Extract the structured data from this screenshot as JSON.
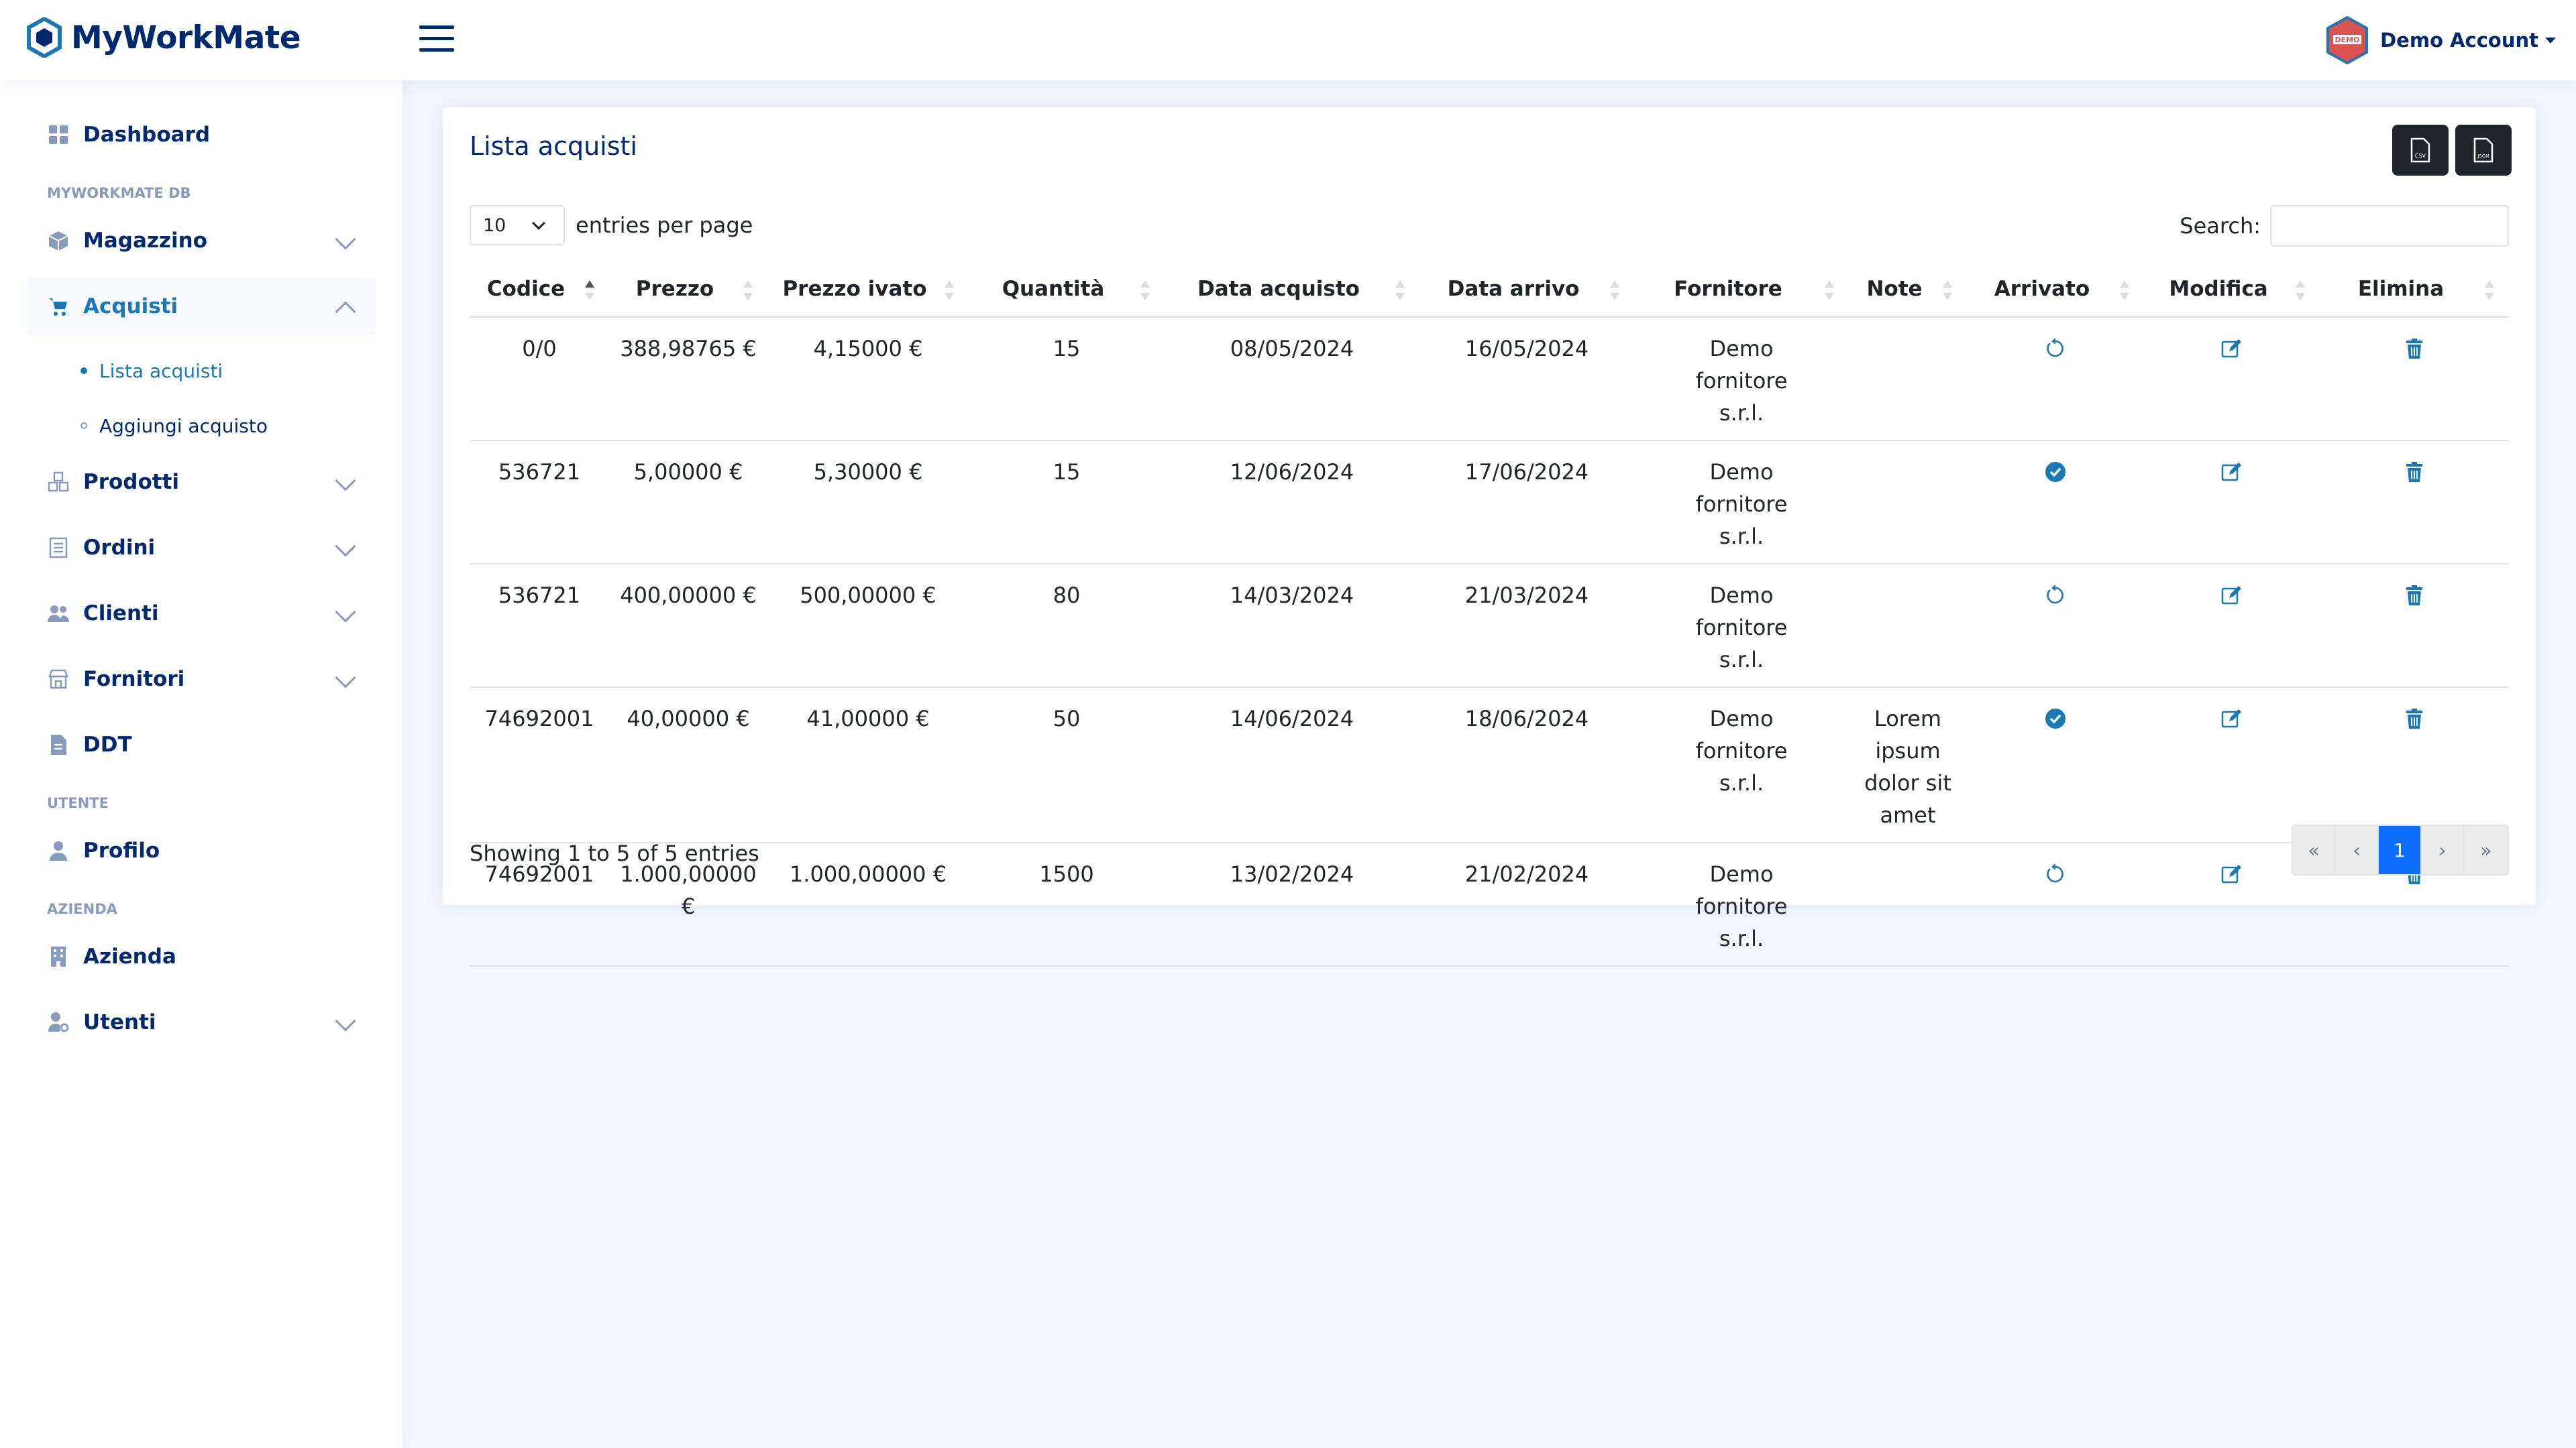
{
  "header": {
    "logo_text": "MyWorkMate",
    "account_name": "Demo Account",
    "avatar_badge": "DEMO"
  },
  "sidebar": {
    "dashboard": "Dashboard",
    "heading_db": "MYWORKMATE DB",
    "magazzino": "Magazzino",
    "acquisti": "Acquisti",
    "lista_acquisti": "Lista acquisti",
    "aggiungi_acquisto": "Aggiungi acquisto",
    "prodotti": "Prodotti",
    "ordini": "Ordini",
    "clienti": "Clienti",
    "fornitori": "Fornitori",
    "ddt": "DDT",
    "heading_utente": "UTENTE",
    "profilo": "Profilo",
    "heading_azienda": "AZIENDA",
    "azienda": "Azienda",
    "utenti": "Utenti"
  },
  "main": {
    "title": "Lista acquisti",
    "export_csv": "CSV",
    "export_json": "JSON",
    "entries_value": "10",
    "entries_label": "entries per page",
    "search_label": "Search:",
    "search_value": "",
    "columns": [
      "Codice",
      "Prezzo",
      "Prezzo ivato",
      "Quantità",
      "Data acquisto",
      "Data arrivo",
      "Fornitore",
      "Note",
      "Arrivato",
      "Modifica",
      "Elimina"
    ],
    "rows": [
      {
        "codice": "0/0",
        "prezzo": "388,98765 €",
        "prezzo_ivato": "4,15000 €",
        "quantita": "15",
        "data_acquisto": "08/05/2024",
        "data_arrivo": "16/05/2024",
        "fornitore": "Demo fornitore s.r.l.",
        "note": "",
        "arrivato": "pending"
      },
      {
        "codice": "536721",
        "prezzo": "5,00000 €",
        "prezzo_ivato": "5,30000 €",
        "quantita": "15",
        "data_acquisto": "12/06/2024",
        "data_arrivo": "17/06/2024",
        "fornitore": "Demo fornitore s.r.l.",
        "note": "",
        "arrivato": "arrived"
      },
      {
        "codice": "536721",
        "prezzo": "400,00000 €",
        "prezzo_ivato": "500,00000 €",
        "quantita": "80",
        "data_acquisto": "14/03/2024",
        "data_arrivo": "21/03/2024",
        "fornitore": "Demo fornitore s.r.l.",
        "note": "",
        "arrivato": "pending"
      },
      {
        "codice": "74692001",
        "prezzo": "40,00000 €",
        "prezzo_ivato": "41,00000 €",
        "quantita": "50",
        "data_acquisto": "14/06/2024",
        "data_arrivo": "18/06/2024",
        "fornitore": "Demo fornitore s.r.l.",
        "note": "Lorem ipsum dolor sit amet",
        "arrivato": "arrived"
      },
      {
        "codice": "74692001",
        "prezzo": "1.000,00000 €",
        "prezzo_ivato": "1.000,00000 €",
        "quantita": "1500",
        "data_acquisto": "13/02/2024",
        "data_arrivo": "21/02/2024",
        "fornitore": "Demo fornitore s.r.l.",
        "note": "",
        "arrivato": "pending"
      }
    ],
    "footer_info": "Showing 1 to 5 of 5 entries",
    "pager": {
      "first": "«",
      "prev": "‹",
      "current": "1",
      "next": "›",
      "last": "»"
    }
  },
  "colors": {
    "brand": "#012970",
    "accent": "#1a78b5",
    "page_active": "#0d6efd"
  }
}
